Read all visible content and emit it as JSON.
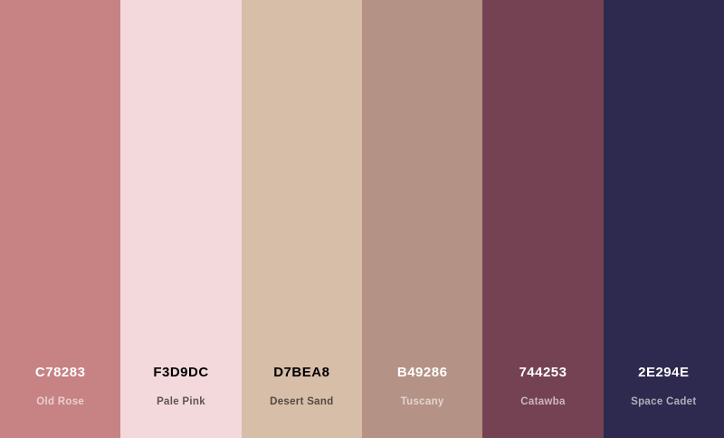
{
  "swatches": [
    {
      "hex": "C78283",
      "name": "Old Rose",
      "color": "#C78283",
      "text_tone": "light"
    },
    {
      "hex": "F3D9DC",
      "name": "Pale Pink",
      "color": "#F3D9DC",
      "text_tone": "dark"
    },
    {
      "hex": "D7BEA8",
      "name": "Desert Sand",
      "color": "#D7BEA8",
      "text_tone": "dark"
    },
    {
      "hex": "B49286",
      "name": "Tuscany",
      "color": "#B49286",
      "text_tone": "light"
    },
    {
      "hex": "744253",
      "name": "Catawba",
      "color": "#744253",
      "text_tone": "light"
    },
    {
      "hex": "2E294E",
      "name": "Space Cadet",
      "color": "#2E294E",
      "text_tone": "light"
    }
  ]
}
